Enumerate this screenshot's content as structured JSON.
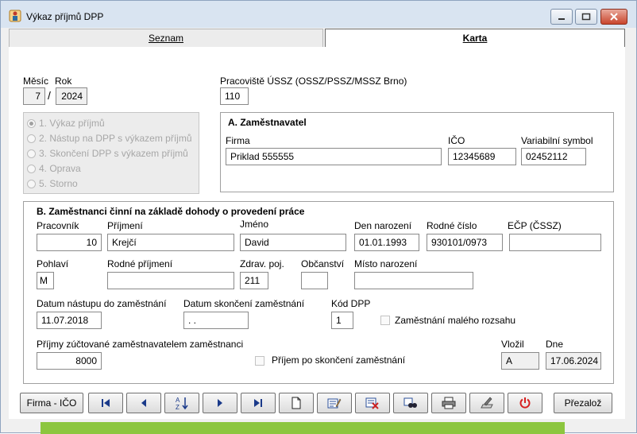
{
  "window": {
    "title": "Výkaz příjmů DPP"
  },
  "tabs": [
    {
      "label": "Seznam",
      "active": false
    },
    {
      "label": "Karta",
      "active": true
    }
  ],
  "period": {
    "month_label": "Měsíc",
    "year_label": "Rok",
    "month": "7",
    "separator": "/",
    "year": "2024"
  },
  "ossz": {
    "label": "Pracoviště ÚSSZ (OSSZ/PSSZ/MSSZ Brno)",
    "value": "110"
  },
  "report_type": {
    "options": [
      "1. Výkaz příjmů",
      "2. Nástup na DPP s výkazem příjmů",
      "3. Skončení DPP s výkazem příjmů",
      "4. Oprava",
      "5. Storno"
    ],
    "selected_index": 0
  },
  "employer": {
    "title": "A. Zaměstnavatel",
    "firma_label": "Firma",
    "firma": "Priklad 555555",
    "ico_label": "IČO",
    "ico": "12345689",
    "vs_label": "Variabilní symbol",
    "vs": "02452112"
  },
  "employee": {
    "title": "B. Zaměstnanci činní na základě dohody o provedení práce",
    "pracovnik_label": "Pracovník",
    "pracovnik": "10",
    "prijmeni_label": "Příjmení",
    "prijmeni": "Krejčí",
    "jmeno_label": "Jméno",
    "jmeno": "David",
    "den_narozeni_label": "Den narození",
    "den_narozeni": "01.01.1993",
    "rodne_cislo_label": "Rodné číslo",
    "rodne_cislo": "930101/0973",
    "ecp_label": "EČP (ČSSZ)",
    "ecp": "",
    "pohlavi_label": "Pohlaví",
    "pohlavi": "M",
    "rodne_prijmeni_label": "Rodné příjmení",
    "rodne_prijmeni": "",
    "zdrav_poj_label": "Zdrav. poj.",
    "zdrav_poj": "211",
    "obcanstvi_label": "Občanství",
    "obcanstvi": "",
    "misto_narozeni_label": "Místo narození",
    "misto_narozeni": "",
    "datum_nastupu_label": "Datum nástupu do zaměstnání",
    "datum_nastupu": "11.07.2018",
    "datum_skonceni_label": "Datum skončení zaměstnání",
    "datum_skonceni": " . .",
    "kod_dpp_label": "Kód DPP",
    "kod_dpp": "1",
    "maly_rozsah_label": "Zaměstnání malého rozsahu",
    "prijmy_label": "Příjmy zúčtované zaměstnavatelem zaměstnanci",
    "prijmy": "8000",
    "po_skonceni_label": "Příjem po skončení zaměstnání",
    "vlozil_label": "Vložil",
    "vlozil": "A",
    "dne_label": "Dne",
    "dne": "17.06.2024"
  },
  "toolbar": {
    "firma_ico": "Firma - IČO",
    "prezaloz": "Přezalož"
  },
  "colors": {
    "titlebar": "#d9e4f1",
    "window_bg": "#f0f0f0",
    "close_button": "#c9452c",
    "delete_icon": "#cc2222",
    "power_icon": "#d62020"
  },
  "icons": [
    "first-record-icon",
    "previous-record-icon",
    "sort-az-icon",
    "next-record-icon",
    "last-record-icon",
    "new-record-icon",
    "edit-icon",
    "delete-icon",
    "search-icon",
    "print-icon",
    "export-icon",
    "power-icon"
  ]
}
